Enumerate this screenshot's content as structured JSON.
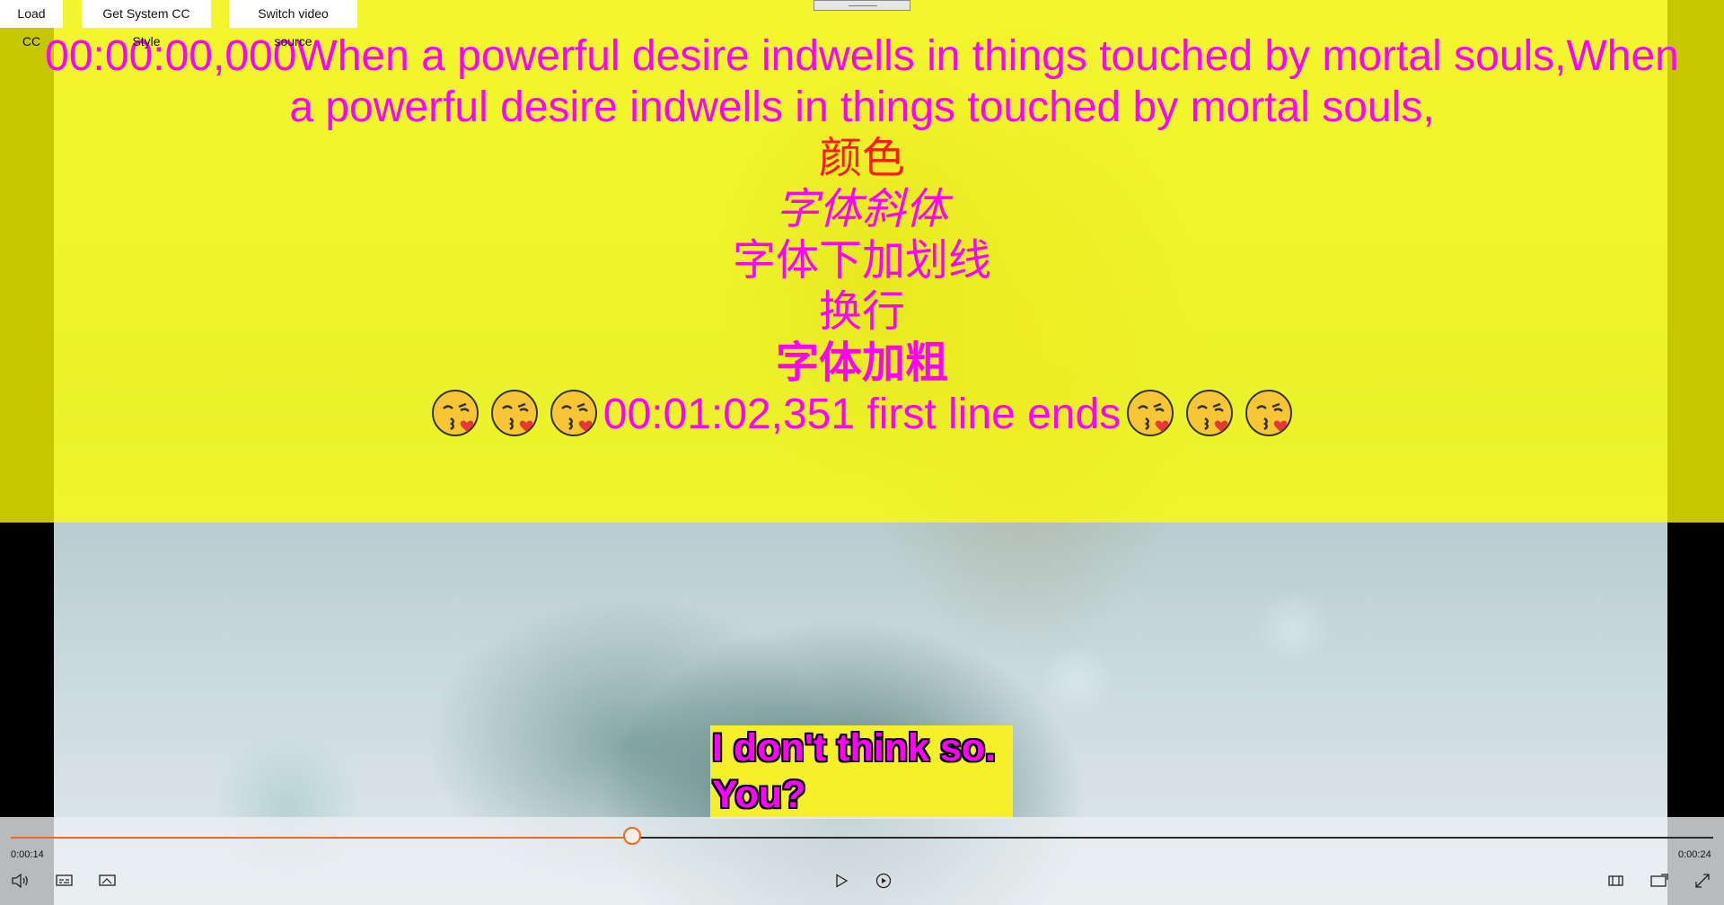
{
  "toolbar": {
    "load_cc": "Load CC",
    "get_style": "Get System CC Style",
    "switch_source": "Switch video source"
  },
  "cc_window": {
    "line1a": "00:00:00,000When a powerful desire indwells in things touched by mortal souls,When",
    "line1b": "a powerful desire indwells in things touched by mortal souls,",
    "color_text": "颜色",
    "italic_text": "字体斜体",
    "underline_text": "字体下加划线",
    "newline_text": "换行",
    "bold_text": "字体加粗",
    "last_line_text": "00:01:02,351 first line ends",
    "emoji_name": "kissing-face-with-heart-emoji"
  },
  "caption": {
    "line1": "I don't think so.",
    "line2": "You?"
  },
  "player": {
    "elapsed": "0:00:14",
    "total": "0:00:24",
    "progress_fraction": 0.365,
    "accent_color": "#f26522",
    "icons": [
      "volume-icon",
      "captions-icon",
      "cast-icon",
      "play-icon",
      "replay-icon",
      "compact-overlay-icon",
      "picture-in-picture-icon",
      "fullscreen-icon"
    ]
  },
  "colors": {
    "cc_background": "#ffff00",
    "cc_foreground": "#ff00ff",
    "cc_accent_red": "#ff1a1a"
  }
}
